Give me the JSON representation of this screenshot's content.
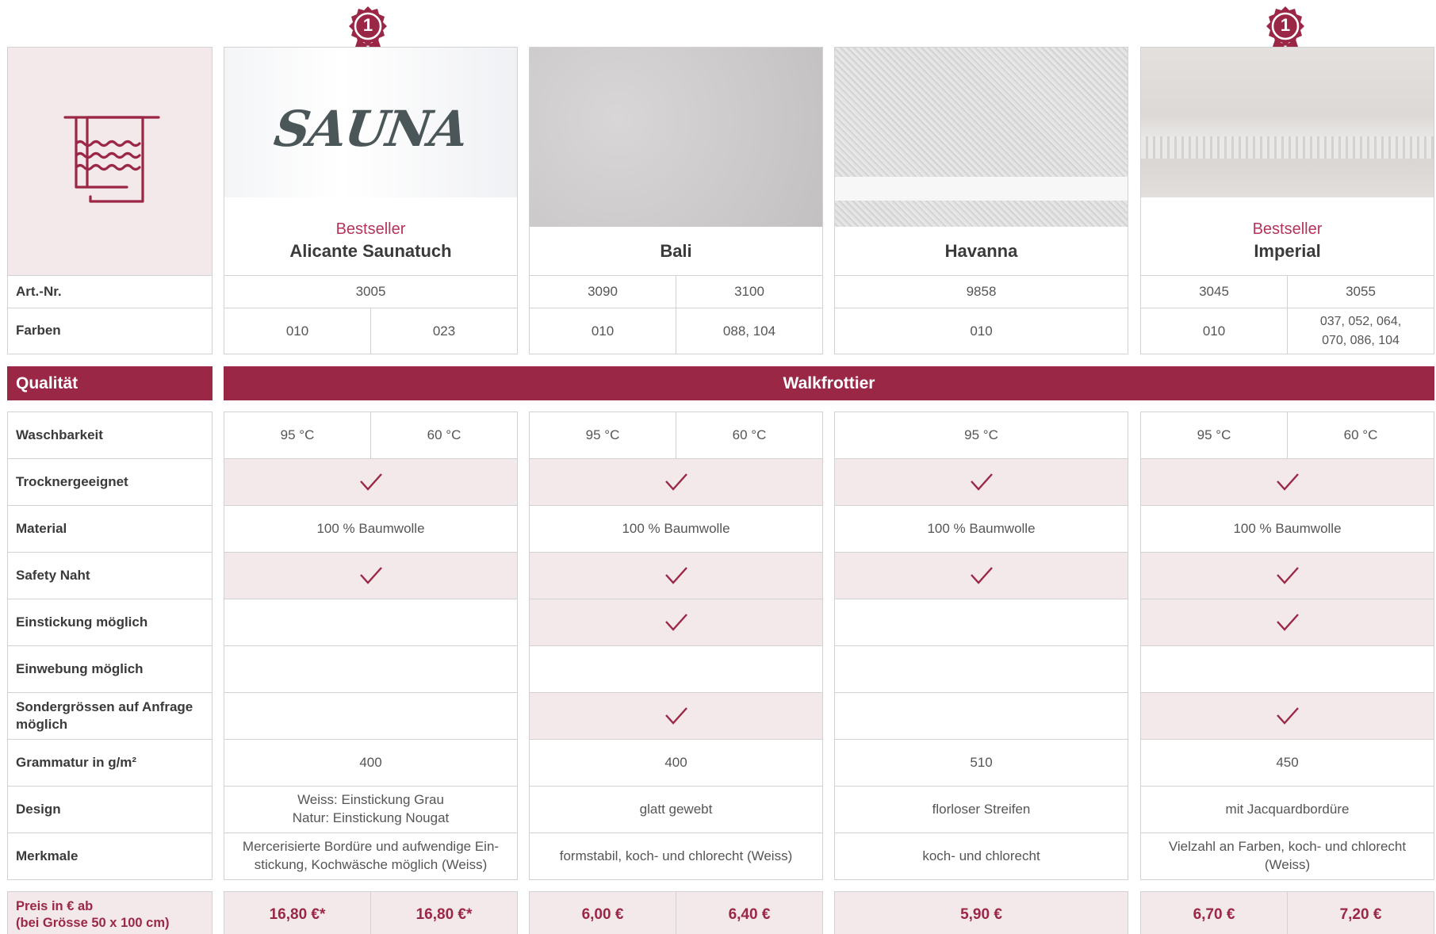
{
  "colors": {
    "accent": "#9b2746",
    "pink_bg": "#f3e8ea",
    "border": "#d2d2d2"
  },
  "icons": {
    "towel": "towel-icon",
    "badge": "ribbon-badge-icon",
    "check": "checkmark-icon"
  },
  "badge_number": "1",
  "products": [
    {
      "bestseller": "Bestseller",
      "name": "Alicante Saunatuch",
      "image_text": "SAUNA",
      "badge": true
    },
    {
      "bestseller": "",
      "name": "Bali",
      "badge": false
    },
    {
      "bestseller": "",
      "name": "Havanna",
      "badge": false
    },
    {
      "bestseller": "Bestseller",
      "name": "Imperial",
      "badge": true
    }
  ],
  "rows": {
    "art_nr": {
      "label": "Art.-Nr.",
      "values": [
        "3005",
        "3090",
        "3100",
        "9858",
        "3045",
        "3055"
      ]
    },
    "farben": {
      "label": "Farben",
      "values": [
        "010",
        "023",
        "010",
        "088, 104",
        "010",
        "010",
        "037, 052, 064,",
        "070, 086, 104"
      ]
    }
  },
  "quality": {
    "label": "Qualität",
    "value": "Walkfrottier"
  },
  "features": [
    {
      "label": "Waschbarkeit",
      "values": [
        "95 °C",
        "60 °C",
        "95 °C",
        "60 °C",
        "95 °C",
        "95 °C",
        "60 °C"
      ]
    },
    {
      "label": "Trocknergeeignet",
      "checks": [
        true,
        true,
        true,
        true
      ]
    },
    {
      "label": "Material",
      "values": [
        "100 % Baumwolle",
        "100 % Baumwolle",
        "100 % Baumwolle",
        "100 % Baumwolle"
      ]
    },
    {
      "label": "Safety Naht",
      "checks": [
        true,
        true,
        true,
        true
      ]
    },
    {
      "label": "Einstickung möglich",
      "checks": [
        false,
        true,
        false,
        true
      ]
    },
    {
      "label": "Einwebung möglich",
      "checks": [
        false,
        false,
        false,
        false
      ]
    },
    {
      "label": "Sondergrössen auf Anfrage möglich",
      "label_line1": "Sondergrössen auf Anfrage",
      "label_line2": "möglich",
      "checks": [
        false,
        true,
        false,
        true
      ]
    },
    {
      "label": "Grammatur in g/m²",
      "values": [
        "400",
        "400",
        "510",
        "450"
      ]
    },
    {
      "label": "Design",
      "values": [
        "Weiss: Einstickung Grau",
        "Natur: Einstickung Nougat",
        "glatt gewebt",
        "florloser Streifen",
        "mit Jacquardbordüre"
      ]
    },
    {
      "label": "Merkmale",
      "values": [
        "Mercerisierte Bordüre und aufwendige Ein-",
        "stickung, Kochwäsche möglich (Weiss)",
        "formstabil, koch- und chlorecht (Weiss)",
        "koch- und chlorecht",
        "Vielzahl an Farben, koch- und chlorecht",
        "(Weiss)"
      ]
    }
  ],
  "price": {
    "label_line1": "Preis in € ab",
    "label_line2": "(bei Grösse 50 x 100 cm)",
    "values": [
      "16,80 €*",
      "16,80 €*",
      "6,00 €",
      "6,40 €",
      "5,90 €",
      "6,70 €",
      "7,20 €"
    ]
  }
}
